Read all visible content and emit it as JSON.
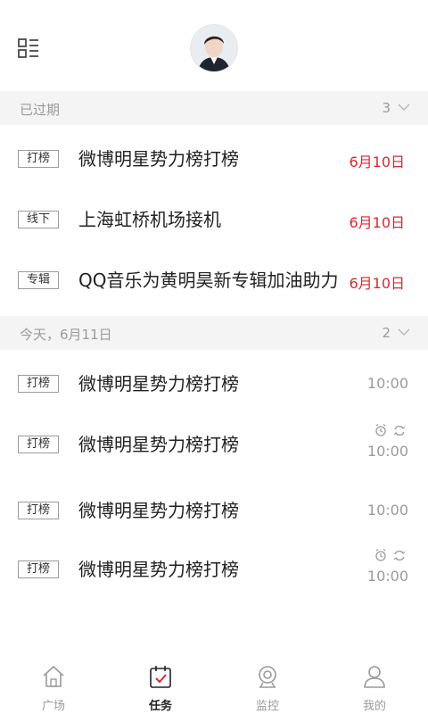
{
  "header": {
    "menu_icon": "list-menu-icon",
    "avatar_icon": "user-avatar"
  },
  "sections": [
    {
      "title": "已过期",
      "count": "3",
      "tasks": [
        {
          "tag": "打榜",
          "title": "微博明星势力榜打榜",
          "date": "6月10日"
        },
        {
          "tag": "线下",
          "title": "上海虹桥机场接机",
          "date": "6月10日"
        },
        {
          "tag": "专辑",
          "title": "QQ音乐为黄明昊新专辑加油助力",
          "date": "6月10日"
        }
      ]
    },
    {
      "title": "今天，6月11日",
      "count": "2",
      "tasks": [
        {
          "tag": "打榜",
          "title": "微博明星势力榜打榜",
          "time": "10:00"
        },
        {
          "tag": "打榜",
          "title": "微博明星势力榜打榜",
          "time": "10:00",
          "icons": [
            "alarm-icon",
            "repeat-icon"
          ]
        },
        {
          "tag": "打榜",
          "title": "微博明星势力榜打榜",
          "time": "10:00"
        },
        {
          "tag": "打榜",
          "title": "微博明星势力榜打榜",
          "time": "10:00",
          "icons": [
            "alarm-icon",
            "repeat-icon"
          ]
        }
      ]
    }
  ],
  "tabs": [
    {
      "label": "广场",
      "icon": "home-icon"
    },
    {
      "label": "任务",
      "icon": "task-calendar-icon",
      "active": true
    },
    {
      "label": "监控",
      "icon": "webcam-icon"
    },
    {
      "label": "我的",
      "icon": "user-icon"
    }
  ],
  "colors": {
    "accent": "#e0252c",
    "muted": "#9a9a9a",
    "section_bg": "#f4f4f4"
  }
}
